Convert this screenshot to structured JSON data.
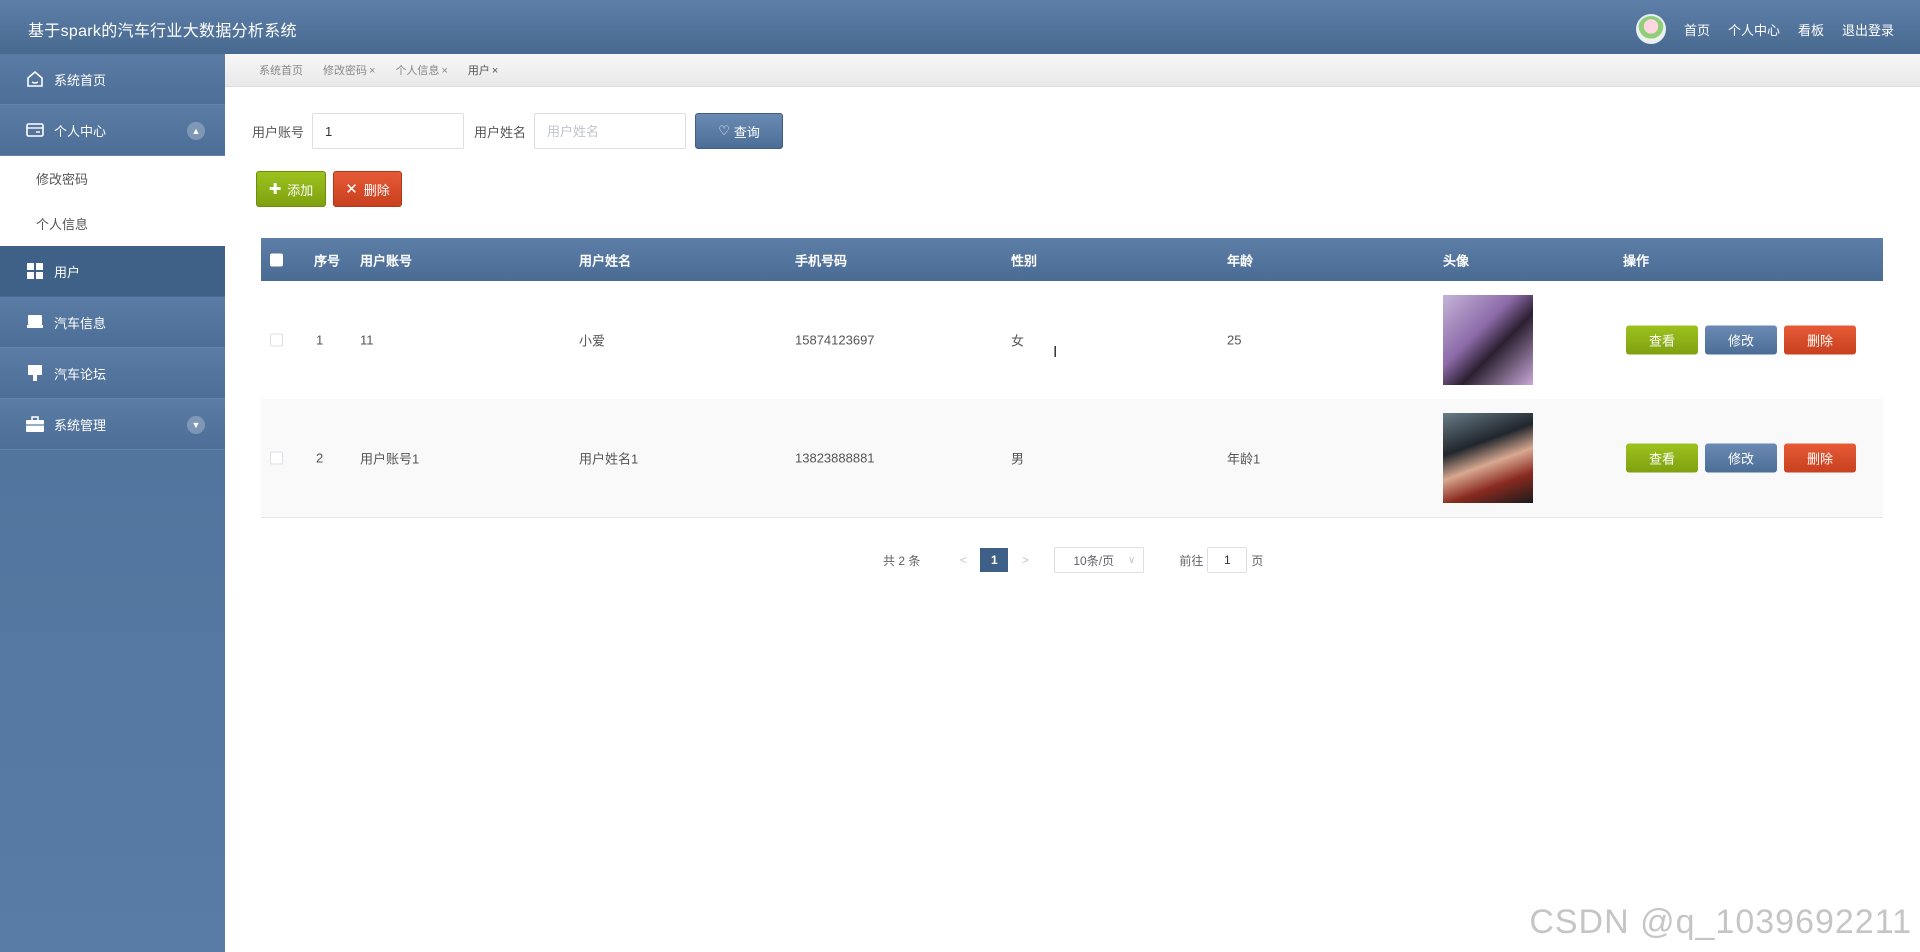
{
  "header": {
    "title": "基于spark的汽车行业大数据分析系统",
    "links": [
      "首页",
      "个人中心",
      "看板",
      "退出登录"
    ]
  },
  "sidebar": {
    "items": [
      {
        "label": "系统首页",
        "icon": "home-icon"
      },
      {
        "label": "个人中心",
        "icon": "profile-card-icon",
        "expanded": true,
        "children": [
          "修改密码",
          "个人信息"
        ]
      },
      {
        "label": "用户",
        "icon": "grid-icon",
        "active": true
      },
      {
        "label": "汽车信息",
        "icon": "car-info-icon"
      },
      {
        "label": "汽车论坛",
        "icon": "forum-icon"
      },
      {
        "label": "系统管理",
        "icon": "briefcase-icon",
        "expanded": false
      }
    ]
  },
  "tabs": [
    {
      "label": "系统首页",
      "closable": false
    },
    {
      "label": "修改密码",
      "closable": true
    },
    {
      "label": "个人信息",
      "closable": true
    },
    {
      "label": "用户",
      "closable": true
    }
  ],
  "search": {
    "account_label": "用户账号",
    "account_value": "1",
    "name_label": "用户姓名",
    "name_placeholder": "用户姓名",
    "query_button": "查询"
  },
  "actions": {
    "add": "添加",
    "delete": "删除"
  },
  "table": {
    "columns": [
      "序号",
      "用户账号",
      "用户姓名",
      "手机号码",
      "性别",
      "年龄",
      "头像",
      "操作"
    ],
    "rows": [
      {
        "index": "1",
        "account": "11",
        "name": "小爱",
        "phone": "15874123697",
        "gender": "女",
        "age": "25"
      },
      {
        "index": "2",
        "account": "用户账号1",
        "name": "用户姓名1",
        "phone": "13823888881",
        "gender": "男",
        "age": "年龄1"
      }
    ],
    "row_actions": {
      "view": "查看",
      "edit": "修改",
      "delete": "删除"
    }
  },
  "pagination": {
    "total": "共 2 条",
    "prev": "<",
    "current_page": "1",
    "next": ">",
    "page_size": "10条/页",
    "goto_prefix": "前往",
    "goto_value": "1",
    "goto_suffix": "页"
  },
  "watermark": "CSDN @q_1039692211",
  "colors": {
    "primary": "#4c6e96",
    "success": "#8bb117",
    "danger": "#d84a28"
  }
}
